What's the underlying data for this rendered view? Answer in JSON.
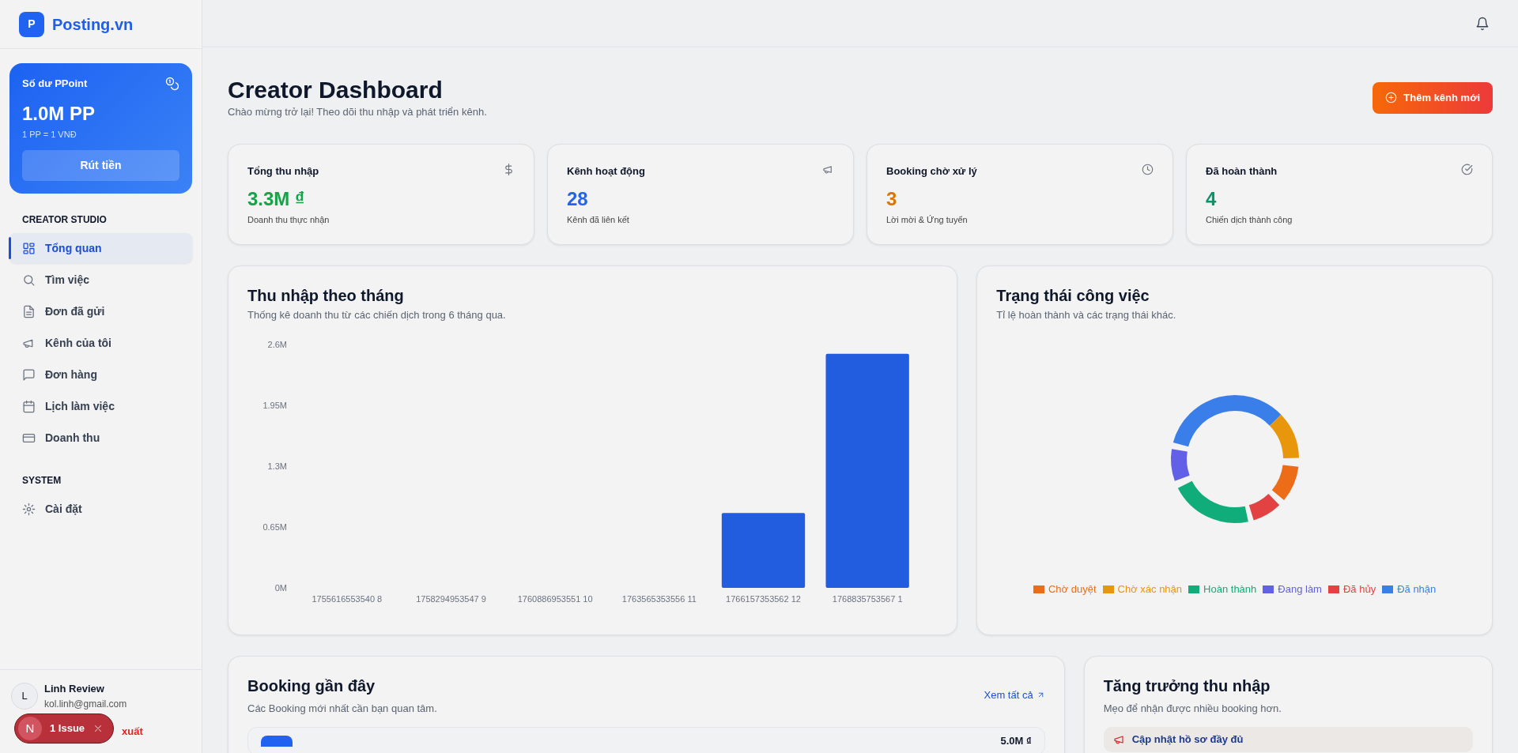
{
  "brand": {
    "logo_letter": "P",
    "name": "Posting.vn"
  },
  "balance": {
    "label": "Số dư PPoint",
    "amount": "1.0M PP",
    "rate": "1 PP = 1 VNĐ",
    "button": "Rút tiền"
  },
  "nav_sections": [
    {
      "title": "CREATOR STUDIO",
      "items": [
        {
          "label": "Tổng quan",
          "selected": true
        },
        {
          "label": "Tìm việc",
          "selected": false
        },
        {
          "label": "Đơn đã gửi",
          "selected": false
        },
        {
          "label": "Kênh của tôi",
          "selected": false
        },
        {
          "label": "Đơn hàng",
          "selected": false
        },
        {
          "label": "Lịch làm việc",
          "selected": false
        },
        {
          "label": "Doanh thu",
          "selected": false
        }
      ]
    },
    {
      "title": "SYSTEM",
      "items": [
        {
          "label": "Cài đặt",
          "selected": false
        }
      ]
    }
  ],
  "user": {
    "initial": "L",
    "name": "Linh Review",
    "email": "kol.linh@gmail.com"
  },
  "logout": "xuất",
  "issue_badge": {
    "letter": "N",
    "label": "1 Issue"
  },
  "page": {
    "title": "Creator Dashboard",
    "subtitle": "Chào mừng trở lại! Theo dõi thu nhập và phát triển kênh.",
    "add_button": "Thêm kênh mới"
  },
  "stats": [
    {
      "label": "Tổng thu nhập",
      "value": "3.3M ₫",
      "color": "#16a34a",
      "note": "Doanh thu thực nhận"
    },
    {
      "label": "Kênh hoạt động",
      "value": "28",
      "color": "#2563eb",
      "note": "Kênh đã liên kết"
    },
    {
      "label": "Booking chờ xử lý",
      "value": "3",
      "color": "#d97706",
      "note": "Lời mời & Ứng tuyển"
    },
    {
      "label": "Đã hoàn thành",
      "value": "4",
      "color": "#059669",
      "note": "Chiến dịch thành công"
    }
  ],
  "revenue": {
    "title": "Thu nhập theo tháng",
    "subtitle": "Thống kê doanh thu từ các chiến dịch trong 6 tháng qua.",
    "chart_data": {
      "type": "bar",
      "categories": [
        "1755616553540 8",
        "1758294953547 9",
        "1760886953551 10",
        "1763565353556 11",
        "1766157353562 12",
        "1768835753567 1"
      ],
      "series": [
        {
          "color": "#225ddf",
          "values": [
            0,
            0,
            0,
            0,
            800000,
            2500000
          ]
        }
      ],
      "ylim": [
        0,
        2600000
      ],
      "yticks": [
        {
          "value": 0,
          "label": "0M"
        },
        {
          "value": 650000,
          "label": "0.65M"
        },
        {
          "value": 1300000,
          "label": "1.3M"
        },
        {
          "value": 1950000,
          "label": "1.95M"
        },
        {
          "value": 2600000,
          "label": "2.6M"
        }
      ]
    }
  },
  "status": {
    "title": "Trạng thái công việc",
    "subtitle": "Tỉ lệ hoàn thành và các trạng thái khác.",
    "legend": [
      {
        "label": "Chờ duyệt",
        "color": "#ed6c18"
      },
      {
        "label": "Chờ xác nhận",
        "color": "#e8970c"
      },
      {
        "label": "Hoàn thành",
        "color": "#10ad7a"
      },
      {
        "label": "Đang làm",
        "color": "#6160e6"
      },
      {
        "label": "Đã hủy",
        "color": "#e34242"
      },
      {
        "label": "Đã nhận",
        "color": "#397ee9"
      }
    ]
  },
  "bookings": {
    "title": "Booking gần đây",
    "subtitle": "Các Booking mới nhất cần bạn quan tâm.",
    "view_all": "Xem tất cả",
    "items": [
      {
        "amount": "5.0M ₫"
      }
    ]
  },
  "growth": {
    "title": "Tăng trưởng thu nhập",
    "subtitle": "Mẹo để nhận được nhiều booking hơn.",
    "tips": [
      {
        "title": "Cập nhật hồ sơ đầy đủ"
      }
    ]
  }
}
